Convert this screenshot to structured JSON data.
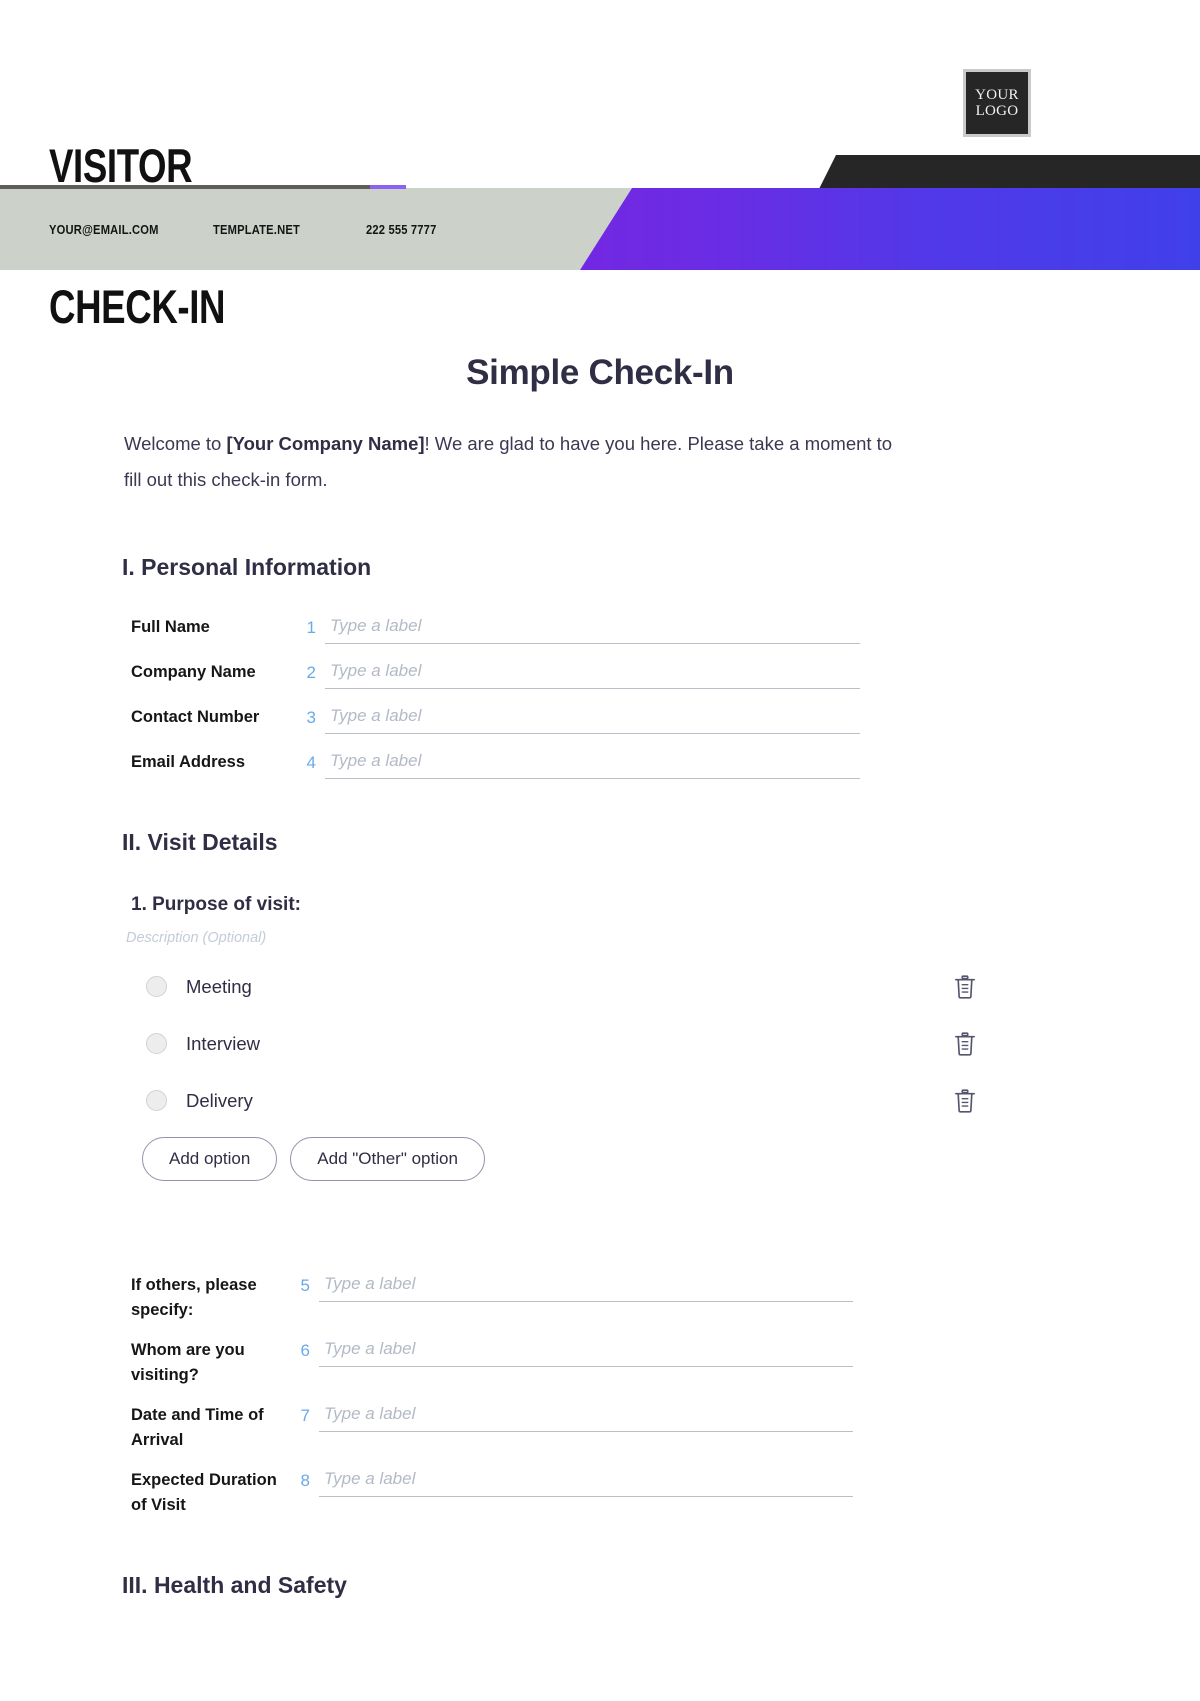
{
  "header": {
    "title_line1": "VISITOR",
    "title_line2": "CHECK-IN",
    "logo_line1": "YOUR",
    "logo_line2": "LOGO",
    "contact": {
      "email": "YOUR@EMAIL.COM",
      "website": "TEMPLATE.NET",
      "phone": "222 555 7777"
    },
    "colors": {
      "gray_band": "#ccd2c9",
      "dark_band": "#262626",
      "purple_start": "#7726e0",
      "purple_end": "#4040ea"
    }
  },
  "page": {
    "title": "Simple Check-In",
    "welcome_prefix": "Welcome to ",
    "welcome_company": "[Your Company Name]",
    "welcome_suffix": "! We are glad to have you here. Please take a moment to fill out this check-in form."
  },
  "sections": {
    "personal": {
      "heading": "I. Personal Information",
      "fields": [
        {
          "label": "Full Name",
          "number": "1",
          "placeholder": "Type a label"
        },
        {
          "label": "Company Name",
          "number": "2",
          "placeholder": "Type a label"
        },
        {
          "label": "Contact Number",
          "number": "3",
          "placeholder": "Type a label"
        },
        {
          "label": "Email Address",
          "number": "4",
          "placeholder": "Type a label"
        }
      ]
    },
    "visit": {
      "heading": "II. Visit Details",
      "question": "1. Purpose of visit:",
      "description": "Description (Optional)",
      "options": [
        {
          "label": "Meeting",
          "delete_icon": "trash-icon"
        },
        {
          "label": "Interview",
          "delete_icon": "trash-icon"
        },
        {
          "label": "Delivery",
          "delete_icon": "trash-icon"
        }
      ],
      "add_option_label": "Add option",
      "add_other_label": "Add \"Other\" option",
      "fields": [
        {
          "label": "If others, please specify:",
          "number": "5",
          "placeholder": "Type a label"
        },
        {
          "label": "Whom are you visiting?",
          "number": "6",
          "placeholder": "Type a label"
        },
        {
          "label": "Date and Time of Arrival",
          "number": "7",
          "placeholder": "Type a label"
        },
        {
          "label": "Expected Duration of Visit",
          "number": "8",
          "placeholder": "Type a label"
        }
      ]
    },
    "health": {
      "heading": "III. Health and Safety"
    }
  }
}
